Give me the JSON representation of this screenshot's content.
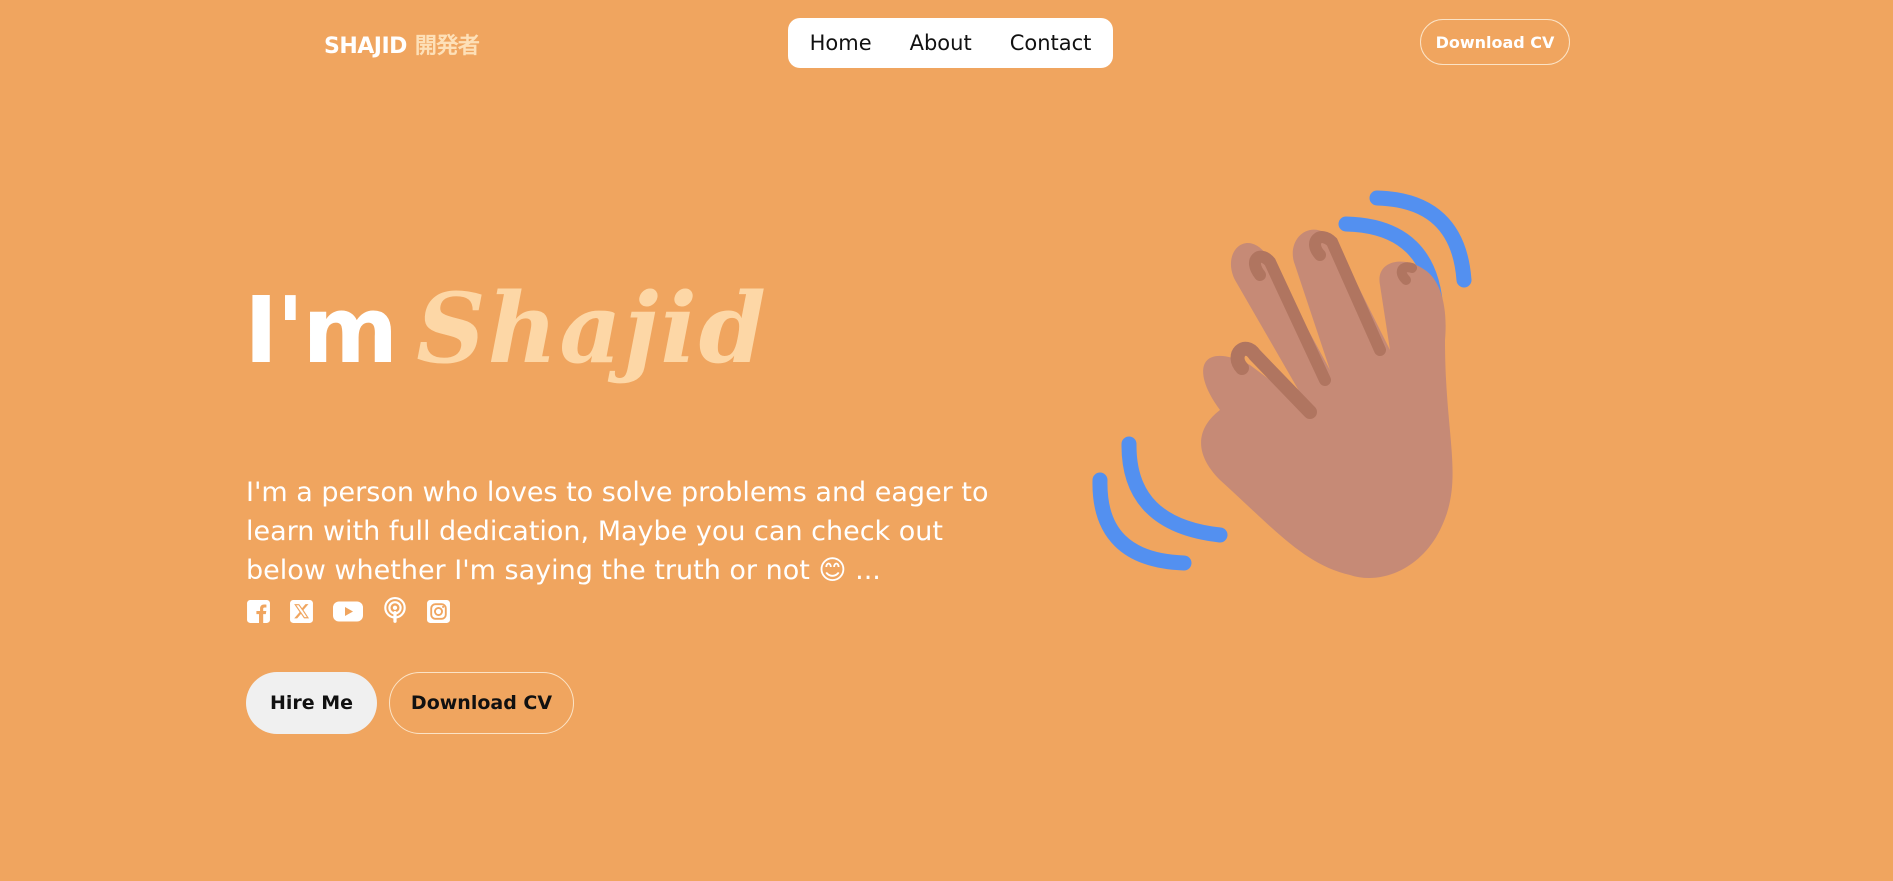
{
  "header": {
    "logo_text": "SHAJID",
    "logo_jp": "開発者",
    "nav": [
      "Home",
      "About",
      "Contact"
    ],
    "download_cv": "Download CV"
  },
  "hero": {
    "prefix": "I'm",
    "name": "Shajid",
    "description": "I'm a person who loves to solve problems and eager to learn with full dedication, Maybe you can check out below whether I'm saying the truth or not 😊 ...",
    "socials": [
      "facebook-icon",
      "x-twitter-icon",
      "youtube-icon",
      "podcast-icon",
      "instagram-icon"
    ],
    "hire_me": "Hire Me",
    "download_cv": "Download CV"
  },
  "colors": {
    "background": "#f0a55f",
    "accent_name": "#fdd7a6",
    "wave_blue": "#5390f0",
    "hand": "#c68a76",
    "hand_shadow": "#b07560"
  }
}
